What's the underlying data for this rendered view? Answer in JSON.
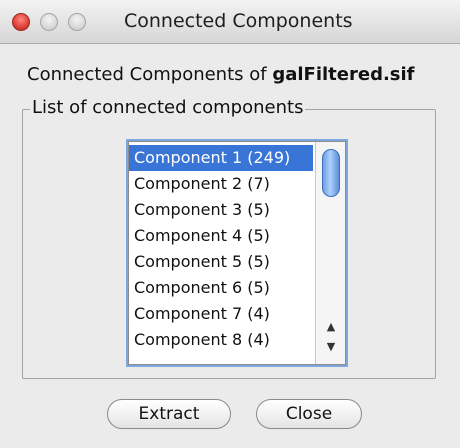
{
  "window": {
    "title": "Connected Components"
  },
  "heading": {
    "prefix": "Connected Components of ",
    "filename": "galFiltered.sif"
  },
  "group": {
    "legend": "List of connected components"
  },
  "list": {
    "items": [
      "Component 1 (249)",
      "Component 2 (7)",
      "Component 3 (5)",
      "Component 4 (5)",
      "Component 5 (5)",
      "Component 6 (5)",
      "Component 7 (4)",
      "Component 8 (4)"
    ],
    "selected_index": 0
  },
  "buttons": {
    "extract": "Extract",
    "close": "Close"
  }
}
